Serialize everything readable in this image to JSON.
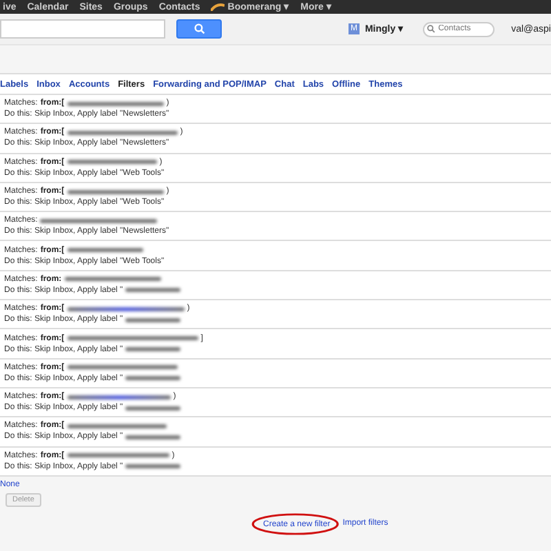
{
  "top_nav": [
    "ive",
    "Calendar",
    "Sites",
    "Groups",
    "Contacts",
    "Boomerang ▾",
    "More ▾"
  ],
  "mingly": {
    "label": "Mingly ▾",
    "badge": "M"
  },
  "contacts_search": {
    "placeholder": "Contacts"
  },
  "account": "val@aspi",
  "tabs": [
    {
      "label": "Labels",
      "selected": false
    },
    {
      "label": "Inbox",
      "selected": false
    },
    {
      "label": "Accounts",
      "selected": false
    },
    {
      "label": "Filters",
      "selected": true
    },
    {
      "label": "Forwarding and POP/IMAP",
      "selected": false
    },
    {
      "label": "Chat",
      "selected": false
    },
    {
      "label": "Labs",
      "selected": false
    },
    {
      "label": "Offline",
      "selected": false
    },
    {
      "label": "Themes",
      "selected": false
    }
  ],
  "filters": [
    {
      "matches": "Matches:",
      "criterion": "from:[",
      "criterion_end": ")",
      "action": "Do this: Skip Inbox, Apply label \"Newsletters\"",
      "action_redacted": false
    },
    {
      "matches": "Matches:",
      "criterion": "from:[",
      "criterion_end": ")",
      "action": "Do this: Skip Inbox, Apply label \"Newsletters\"",
      "action_redacted": false
    },
    {
      "matches": "Matches:",
      "criterion": "from:[",
      "criterion_end": ")",
      "action": "Do this: Skip Inbox, Apply label \"Web Tools\"",
      "action_redacted": false
    },
    {
      "matches": "Matches:",
      "criterion": "from:[",
      "criterion_end": ")",
      "action": "Do this: Skip Inbox, Apply label \"Web Tools\"",
      "action_redacted": false
    },
    {
      "matches": "Matches:",
      "action": "Do this: Skip Inbox, Apply label \"Newsletters\"",
      "action_redacted": false
    },
    {
      "matches": "Matches:",
      "criterion": "from:[",
      "action": "Do this: Skip Inbox, Apply label \"Web Tools\"",
      "action_redacted": false
    },
    {
      "matches": "Matches:",
      "criterion": "from:",
      "action": "Do this: Skip Inbox, Apply label \"",
      "action_redacted": true
    },
    {
      "matches": "Matches:",
      "criterion": "from:[",
      "criterion_end": ")",
      "action": "Do this: Skip Inbox, Apply label \"",
      "action_redacted": true
    },
    {
      "matches": "Matches:",
      "criterion": "from:[",
      "criterion_end": "]",
      "action": "Do this: Skip Inbox, Apply label \"",
      "action_redacted": true
    },
    {
      "matches": "Matches:",
      "criterion": "from:[",
      "action": "Do this: Skip Inbox, Apply label \"",
      "action_redacted": true
    },
    {
      "matches": "Matches:",
      "criterion": "from:[",
      "criterion_end": ")",
      "action": "Do this: Skip Inbox, Apply label \"",
      "action_redacted": true
    },
    {
      "matches": "Matches:",
      "criterion": "from:[",
      "action": "Do this: Skip Inbox, Apply label \"",
      "action_redacted": true
    },
    {
      "matches": "Matches:",
      "criterion": "from:[",
      "criterion_end": ")",
      "action": "Do this: Skip Inbox, Apply label \"",
      "action_redacted": true
    }
  ],
  "select_none": "None",
  "delete_button": "Delete",
  "create_filter": "Create a new filter",
  "import_filters": "Import filters"
}
